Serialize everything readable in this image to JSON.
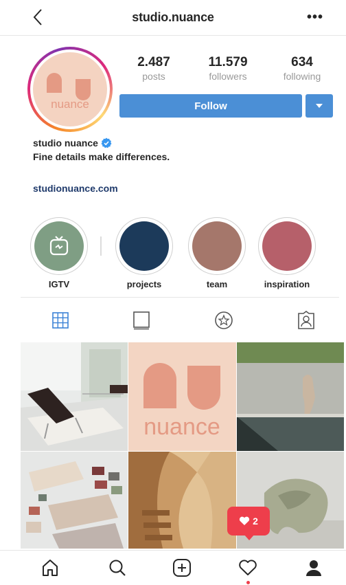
{
  "header": {
    "username": "studio.nuance",
    "back_icon": "chevron-left-icon",
    "more_label": "•••"
  },
  "profile": {
    "avatar_logo_text": "nuance",
    "stats": [
      {
        "value": "2.487",
        "label": "posts"
      },
      {
        "value": "11.579",
        "label": "followers"
      },
      {
        "value": "634",
        "label": "following"
      }
    ],
    "follow_label": "Follow",
    "display_name": "studio nuance",
    "bio": "Fine details make differences.",
    "website": "studionuance.com"
  },
  "highlights": [
    {
      "label": "IGTV",
      "color": "#7f9e84"
    },
    {
      "label": "projects",
      "color": "#1c3a5a"
    },
    {
      "label": "team",
      "color": "#a5776b"
    },
    {
      "label": "inspiration",
      "color": "#b6606a"
    }
  ],
  "tabs": [
    "grid-icon",
    "feed-icon",
    "tagged-star-icon",
    "tagged-person-icon"
  ],
  "colors": {
    "brand_peach": "#e9a28a",
    "follow_blue": "#4b8fd6",
    "link_navy": "#1f3a6b",
    "notif_red": "#ee3e4b"
  },
  "grid": {
    "logo_text": "nuance"
  },
  "notification": {
    "count": "2"
  },
  "bottom_nav": [
    "home-icon",
    "search-icon",
    "new-post-icon",
    "activity-heart-icon",
    "profile-icon"
  ]
}
